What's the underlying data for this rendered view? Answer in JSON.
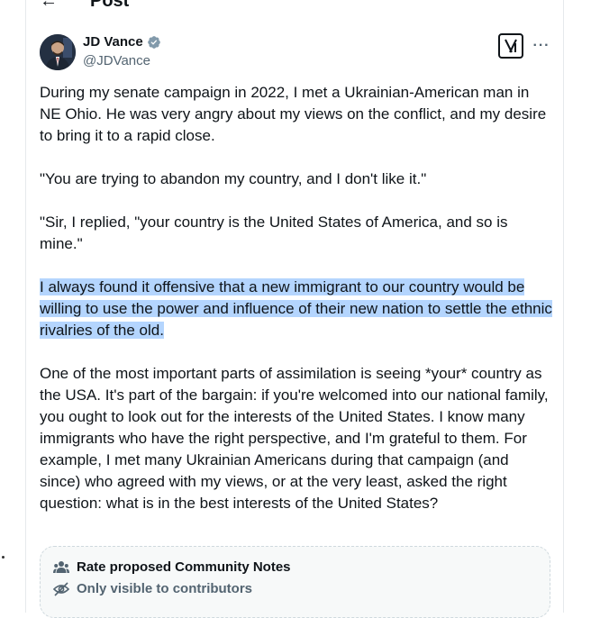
{
  "header": {
    "back_icon": "arrow-left-icon",
    "title": "Post"
  },
  "author": {
    "display_name": "JD Vance",
    "handle": "@JDVance",
    "verified_badge": "verified-badge-icon",
    "verified_color": "#829aab"
  },
  "actions": {
    "grok_icon": "grok-icon",
    "more_label": "···"
  },
  "post": {
    "paragraphs": [
      "During my senate campaign in 2022, I met a Ukrainian-American man in NE Ohio. He was very angry about my views on the conflict, and my desire to bring it to a rapid close.",
      "\"You are trying to abandon my country, and I don't like it.\"",
      "\"Sir, I replied, \"your country is the United States of America, and so is mine.\"",
      "I always found it offensive that a new immigrant to our country would be willing to use the power and influence of their new nation to settle the ethnic rivalries of the old.",
      "One of the most important parts of assimilation is seeing *your* country as the USA. It's part of the bargain: if you're welcomed into our national family, you ought to look out for the interests of the United States.  I know many immigrants who have the right perspective, and I'm grateful to them. For example, I met many Ukrainian Americans during that campaign (and since) who agreed with my views, or at the very least, asked the right question: what is in the best interests of the United States?"
    ],
    "highlight_color": "#b4d5fe"
  },
  "community_notes": {
    "title": "Rate proposed Community Notes",
    "subtitle": "Only visible to contributors",
    "title_icon": "people-icon",
    "subtitle_icon": "eye-off-icon"
  }
}
